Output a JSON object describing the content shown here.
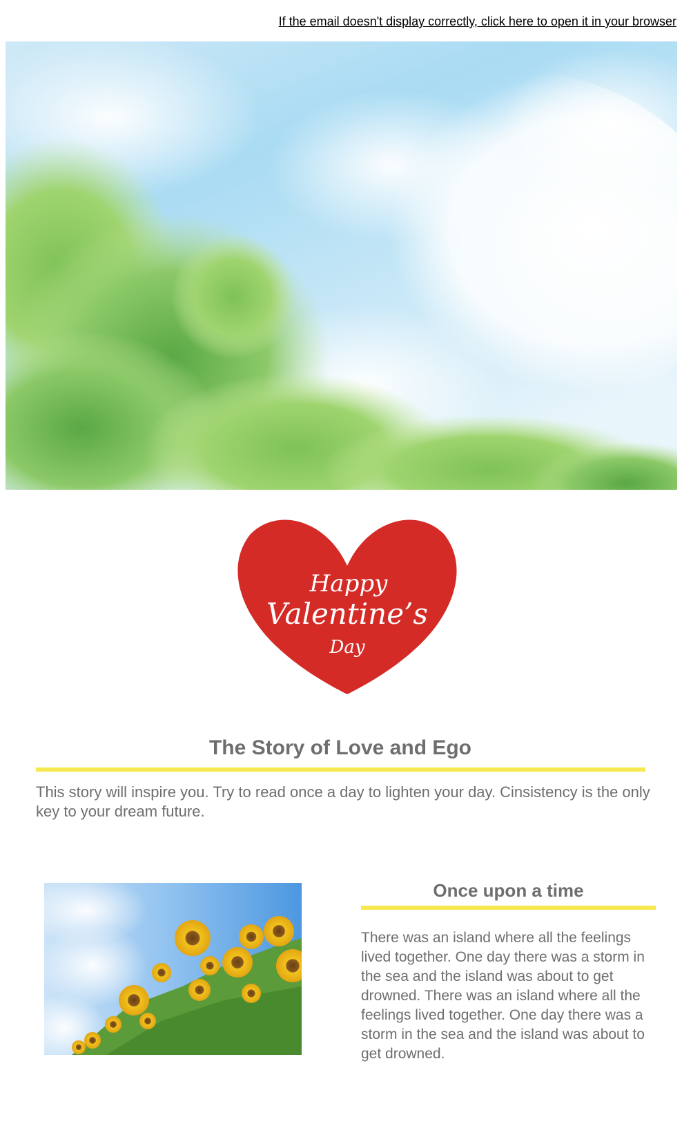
{
  "header": {
    "browser_link": "If the email doesn't display correctly, click here to open it in your browser"
  },
  "hero": {
    "image": "sky-and-trees-image"
  },
  "heart": {
    "line1": "Happy",
    "line2": "Valentine’s",
    "line3": "Day",
    "color": "#d42b27"
  },
  "main": {
    "title": "The Story of Love and Ego",
    "intro": "This story will inspire you. Try to read once a day to lighten your day. Cinsistency is the only key to your dream future."
  },
  "section": {
    "image": "sunflowers-image",
    "title": "Once upon a time",
    "body": "There was an island where all the feelings lived together. One day there was a storm in the sea and the island was about to get drowned. There was an island where all the feelings lived together. One day there was a storm in the sea and the island was about to get drowned."
  },
  "colors": {
    "accent_yellow": "#f6e84e",
    "text_gray": "#6e6e6e",
    "heart_red": "#d42b27"
  }
}
